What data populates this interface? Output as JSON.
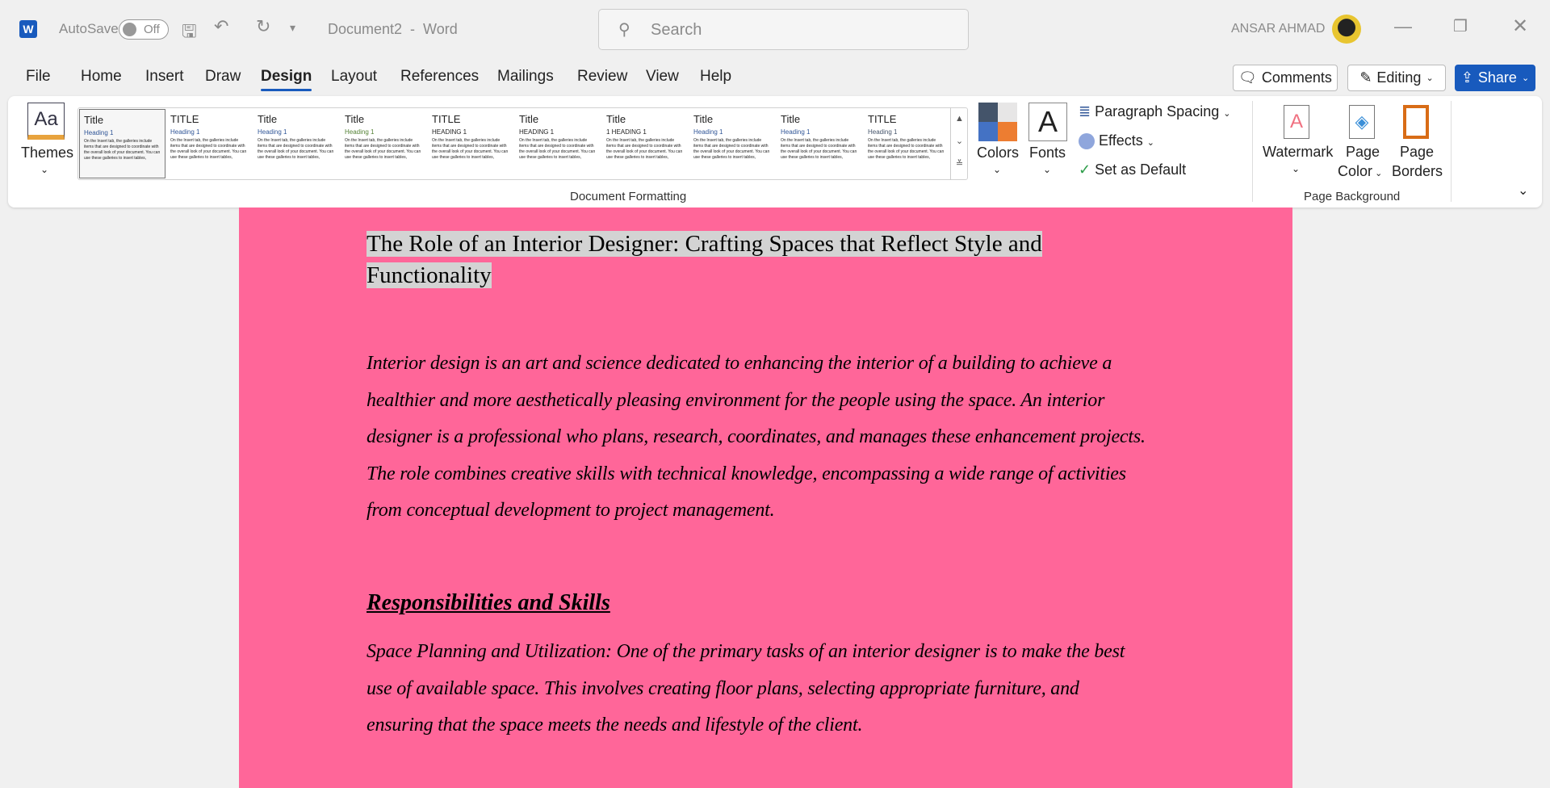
{
  "titlebar": {
    "autosave_label": "AutoSave",
    "autosave_state": "Off",
    "doc_title": "Document2  -  Word",
    "search_placeholder": "Search",
    "user": "ANSAR AHMAD"
  },
  "tabs": [
    "File",
    "Home",
    "Insert",
    "Draw",
    "Design",
    "Layout",
    "References",
    "Mailings",
    "Review",
    "View",
    "Help"
  ],
  "actions": {
    "comments": "Comments",
    "editing": "Editing",
    "share": "Share"
  },
  "ribbon": {
    "themes": "Themes",
    "styles": [
      {
        "title": "Title",
        "heading": "Heading 1"
      },
      {
        "title": "TITLE",
        "heading": "Heading 1"
      },
      {
        "title": "Title",
        "heading": "Heading 1"
      },
      {
        "title": "Title",
        "heading": "Heading 1"
      },
      {
        "title": "TITLE",
        "heading": "HEADING 1"
      },
      {
        "title": "Title",
        "heading": "HEADING 1"
      },
      {
        "title": "Title",
        "heading": "1 HEADING 1"
      },
      {
        "title": "Title",
        "heading": "Heading 1"
      },
      {
        "title": "Title",
        "heading": "Heading 1"
      },
      {
        "title": "TITLE",
        "heading": "Heading 1"
      }
    ],
    "sample_text": "On the Insert tab, the galleries include items that are designed to coordinate with the overall look of your document. You can use these galleries to insert tables,",
    "colors": "Colors",
    "fonts": "Fonts",
    "paragraph_spacing": "Paragraph Spacing",
    "effects": "Effects",
    "set_default": "Set as Default",
    "group_doc_formatting": "Document Formatting",
    "watermark": "Watermark",
    "page_color_1": "Page",
    "page_color_2": "Color",
    "page_borders_1": "Page",
    "page_borders_2": "Borders",
    "group_page_background": "Page Background",
    "page_color_value": "#ff6699"
  },
  "document": {
    "title_line1": "The Role of an Interior Designer: Crafting Spaces that Reflect Style and",
    "title_line2": "Functionality",
    "para1": [
      "Interior design is an art and science dedicated to enhancing the interior of a building to achieve a",
      "healthier and more aesthetically pleasing environment for the people using the space. An interior",
      "designer is a professional who plans, research, coordinates, and manages these enhancement projects.",
      "The role combines creative skills with technical knowledge, encompassing a wide range of activities",
      "from conceptual development to project management."
    ],
    "heading": "Responsibilities and Skills",
    "para2": [
      "Space Planning and Utilization: One of the primary tasks of an interior designer is to make the best",
      "use of available space. This involves creating floor plans, selecting appropriate furniture, and",
      "ensuring that the space meets the needs and lifestyle of the client."
    ]
  }
}
